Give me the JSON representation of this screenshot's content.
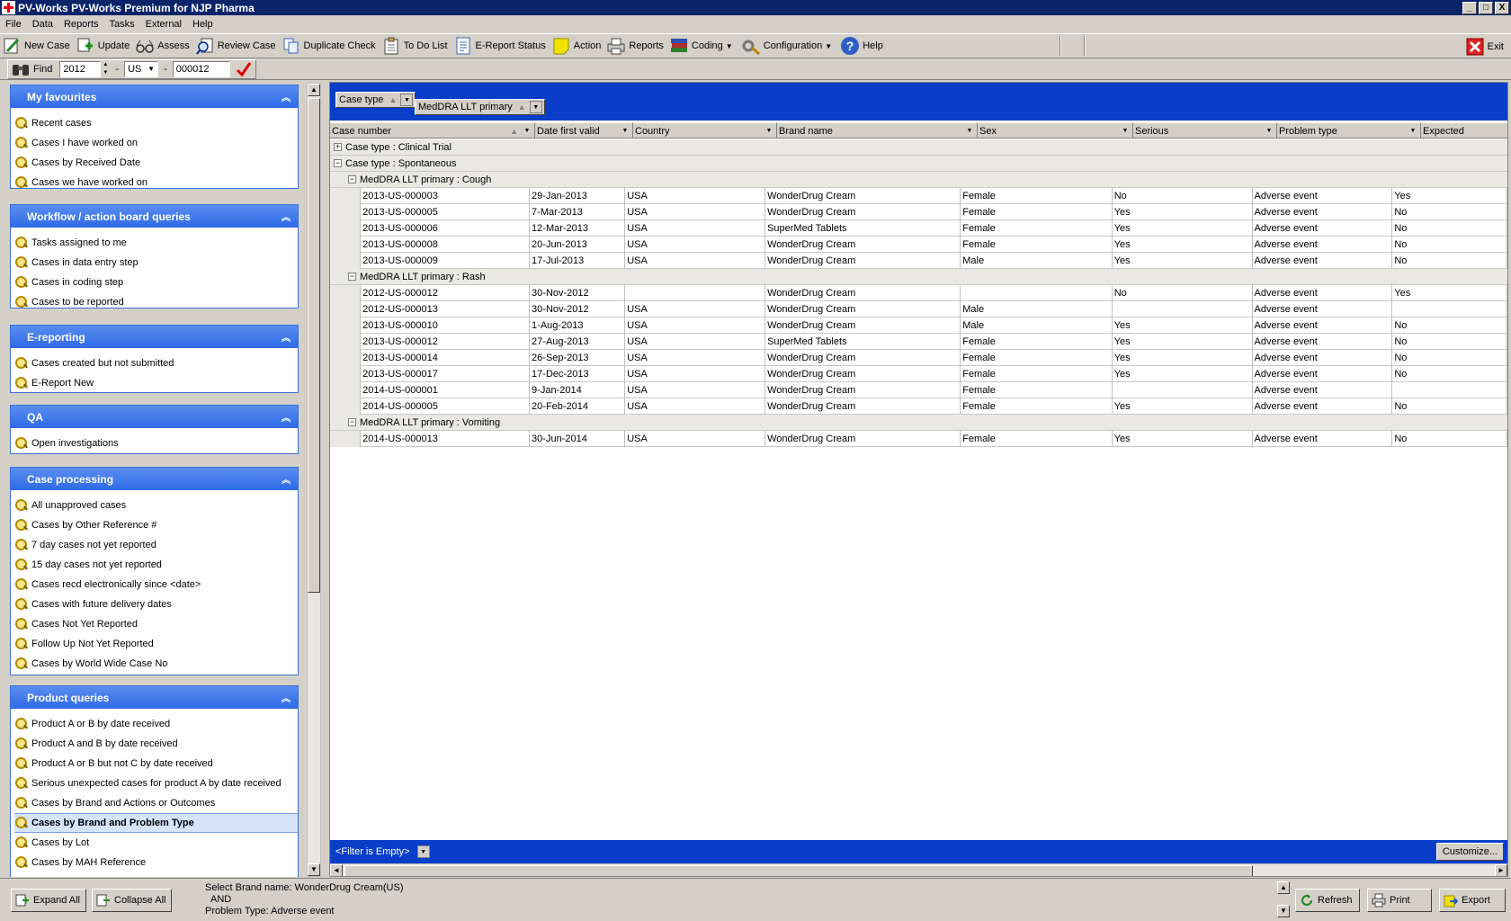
{
  "window": {
    "title": "PV-Works PV-Works Premium for NJP Pharma",
    "min": "_",
    "max": "□",
    "close": "X"
  },
  "menu": [
    "File",
    "Data",
    "Reports",
    "Tasks",
    "External",
    "Help"
  ],
  "toolbar": {
    "new_case": "New Case",
    "update": "Update",
    "assess": "Assess",
    "review_case": "Review Case",
    "duplicate_check": "Duplicate Check",
    "to_do_list": "To Do List",
    "ereport_status": "E-Report Status",
    "action": "Action",
    "reports": "Reports",
    "coding": "Coding",
    "configuration": "Configuration",
    "help": "Help",
    "exit": "Exit"
  },
  "find": {
    "label": "Find",
    "year": "2012",
    "dash1": "-",
    "country": "US",
    "dash2": "-",
    "number": "000012"
  },
  "groups": [
    {
      "title": "My favourites",
      "items": [
        "Recent cases",
        "Cases I have worked on",
        "Cases by Received Date",
        "Cases we have worked on"
      ]
    },
    {
      "title": "Workflow / action board queries",
      "items": [
        "Tasks assigned to me",
        "Cases in data entry step",
        "Cases in coding step",
        "Cases to be reported"
      ]
    },
    {
      "title": "E-reporting",
      "items": [
        "Cases created but not submitted",
        "E-Report New"
      ]
    },
    {
      "title": "QA",
      "items": [
        "Open investigations"
      ]
    },
    {
      "title": "Case processing",
      "items": [
        "All unapproved cases",
        "Cases by Other Reference #",
        "7 day cases not yet reported",
        "15 day cases not yet reported",
        "Cases recd electronically since <date>",
        "Cases with future delivery dates",
        "Cases Not Yet Reported",
        "Follow Up Not Yet Reported",
        "Cases by World Wide Case No"
      ]
    },
    {
      "title": "Product queries",
      "items": [
        "Product A or B by date received",
        "Product A and B by date received",
        "Product A or B but not C by date received",
        "Serious unexpected cases for product A by date received",
        "Cases by Brand and Actions or Outcomes",
        "Cases by Brand and Problem Type",
        "Cases by Lot",
        "Cases by MAH Reference"
      ]
    }
  ],
  "selected_query": "Cases by Brand and Problem Type",
  "grouping": {
    "chip1": "Case type",
    "chip2": "MedDRA LLT primary"
  },
  "columns": [
    "Case number",
    "Date first valid",
    "Country",
    "Brand name",
    "Sex",
    "Serious",
    "Problem type",
    "Expected"
  ],
  "casegroups": {
    "clinical": "Case type : Clinical Trial",
    "spontaneous": "Case type : Spontaneous"
  },
  "subgroups": [
    {
      "label": "MedDRA LLT primary : Cough",
      "rows": [
        [
          "2013-US-000003",
          "29-Jan-2013",
          "USA",
          "WonderDrug Cream",
          "Female",
          "No",
          "Adverse event",
          "Yes"
        ],
        [
          "2013-US-000005",
          "7-Mar-2013",
          "USA",
          "WonderDrug Cream",
          "Female",
          "Yes",
          "Adverse event",
          "No"
        ],
        [
          "2013-US-000006",
          "12-Mar-2013",
          "USA",
          "SuperMed Tablets",
          "Female",
          "Yes",
          "Adverse event",
          "No"
        ],
        [
          "2013-US-000008",
          "20-Jun-2013",
          "USA",
          "WonderDrug Cream",
          "Female",
          "Yes",
          "Adverse event",
          "No"
        ],
        [
          "2013-US-000009",
          "17-Jul-2013",
          "USA",
          "WonderDrug Cream",
          "Male",
          "Yes",
          "Adverse event",
          "No"
        ]
      ]
    },
    {
      "label": "MedDRA LLT primary : Rash",
      "rows": [
        [
          "2012-US-000012",
          "30-Nov-2012",
          "",
          "WonderDrug Cream",
          "",
          "No",
          "Adverse event",
          "Yes"
        ],
        [
          "2012-US-000013",
          "30-Nov-2012",
          "USA",
          "WonderDrug Cream",
          "Male",
          "",
          "Adverse event",
          ""
        ],
        [
          "2013-US-000010",
          "1-Aug-2013",
          "USA",
          "WonderDrug Cream",
          "Male",
          "Yes",
          "Adverse event",
          "No"
        ],
        [
          "2013-US-000012",
          "27-Aug-2013",
          "USA",
          "SuperMed Tablets",
          "Female",
          "Yes",
          "Adverse event",
          "No"
        ],
        [
          "2013-US-000014",
          "26-Sep-2013",
          "USA",
          "WonderDrug Cream",
          "Female",
          "Yes",
          "Adverse event",
          "No"
        ],
        [
          "2013-US-000017",
          "17-Dec-2013",
          "USA",
          "WonderDrug Cream",
          "Female",
          "Yes",
          "Adverse event",
          "No"
        ],
        [
          "2014-US-000001",
          "9-Jan-2014",
          "USA",
          "WonderDrug Cream",
          "Female",
          "",
          "Adverse event",
          ""
        ],
        [
          "2014-US-000005",
          "20-Feb-2014",
          "USA",
          "WonderDrug Cream",
          "Female",
          "Yes",
          "Adverse event",
          "No"
        ]
      ]
    },
    {
      "label": "MedDRA LLT primary : Vomiting",
      "rows": [
        [
          "2014-US-000013",
          "30-Jun-2014",
          "USA",
          "WonderDrug Cream",
          "Female",
          "Yes",
          "Adverse event",
          "No"
        ]
      ]
    }
  ],
  "filter": {
    "text": "<Filter is Empty>",
    "customize": "Customize..."
  },
  "bottom": {
    "expand_all": "Expand All",
    "collapse_all": "Collapse All",
    "status_line1": "Select Brand name: WonderDrug Cream(US)",
    "status_line2": "AND",
    "status_line3": "Problem Type: Adverse event",
    "refresh": "Refresh",
    "print": "Print",
    "export": "Export"
  }
}
